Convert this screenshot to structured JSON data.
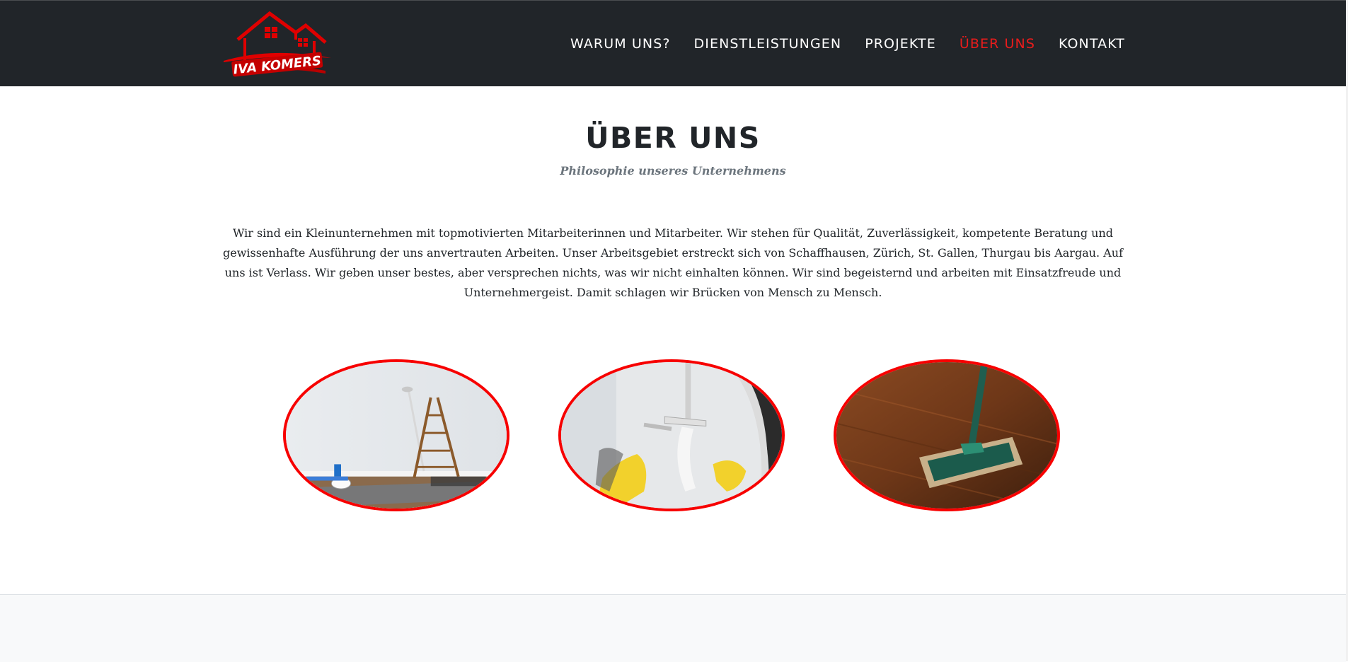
{
  "brand": {
    "name": "IVA KOMERS",
    "logo_icon": "house-roof-logo-icon"
  },
  "nav": {
    "items": [
      {
        "label": "Warum uns?",
        "active": false
      },
      {
        "label": "Dienstleistungen",
        "active": false
      },
      {
        "label": "Projekte",
        "active": false
      },
      {
        "label": "Über uns",
        "active": true
      },
      {
        "label": "Kontakt",
        "active": false
      }
    ]
  },
  "about": {
    "title": "Über uns",
    "subtitle": "Philosophie unseres Unternehmens",
    "text": "Wir sind ein Kleinunternehmen mit topmotivierten Mitarbeiterinnen und Mitarbeiter. Wir stehen für Qualität, Zuverlässigkeit, kompetente Beratung und gewissenhafte Ausführung der uns anvertrauten Arbeiten. Unser Arbeitsgebiet erstreckt sich von Schaffhausen, Zürich, St. Gallen, Thurgau bis Aargau. Auf uns ist Verlass. Wir geben unser bestes, aber versprechen nichts, was wir nicht einhalten können. Wir sind begeisternd und arbeiten mit Einsatzfreude und Unternehmergeist. Damit schlagen wir Brücken von Mensch zu Mensch.",
    "images": [
      {
        "icon": "painting-ladder-photo"
      },
      {
        "icon": "window-cleaning-photo"
      },
      {
        "icon": "floor-mop-photo"
      }
    ]
  },
  "colors": {
    "navbar_bg": "#212529",
    "accent": "#ea1c1c",
    "oval_border": "#f70000",
    "title": "#212529",
    "subtitle": "#6c757d",
    "footer_bg": "#f8f9fa"
  }
}
